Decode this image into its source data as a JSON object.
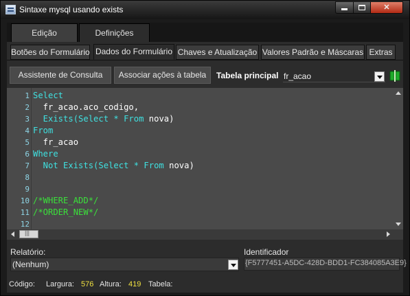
{
  "window": {
    "title": "Sintaxe mysql usando exists"
  },
  "main_tabs": [
    {
      "label": "Edição"
    },
    {
      "label": "Definições"
    }
  ],
  "sub_tabs": [
    {
      "label": "Botões do Formulário"
    },
    {
      "label": "Dados do Formulário"
    },
    {
      "label": "Chaves e Atualização"
    },
    {
      "label": "Valores Padrão e Máscaras"
    },
    {
      "label": "Extras"
    }
  ],
  "toolbar": {
    "query_wizard_label": "Assistente de Consulta",
    "associate_actions_label": "Associar ações à tabela",
    "main_table_label": "Tabela principal",
    "main_table_value": "fr_acao"
  },
  "editor": {
    "line_numbers": [
      "1",
      "2",
      "3",
      "4",
      "5",
      "6",
      "7",
      "8",
      "9",
      "10",
      "11",
      "12"
    ],
    "lines": [
      [
        {
          "t": "Select",
          "c": "kw"
        }
      ],
      [
        {
          "t": "  fr_acao.aco_codigo,",
          "c": "id"
        }
      ],
      [
        {
          "t": "  Exists(Select * From ",
          "c": "kw"
        },
        {
          "t": "nova)",
          "c": "id"
        }
      ],
      [
        {
          "t": "From",
          "c": "kw"
        }
      ],
      [
        {
          "t": "  fr_acao",
          "c": "id"
        }
      ],
      [
        {
          "t": "Where",
          "c": "kw"
        }
      ],
      [
        {
          "t": "  Not Exists(Select * From ",
          "c": "kw"
        },
        {
          "t": "nova)",
          "c": "id"
        }
      ],
      [],
      [],
      [
        {
          "t": "/*WHERE_ADD*/",
          "c": "cm"
        }
      ],
      [
        {
          "t": "/*ORDER_NEW*/",
          "c": "cm"
        }
      ],
      []
    ]
  },
  "footer": {
    "relatorio_label": "Relatório:",
    "relatorio_value": "(Nenhum)",
    "identificador_label": "Identificador",
    "identificador_value": "{F5777451-A5DC-428D-BDD1-FC384085A3E9}"
  },
  "status": {
    "codigo_label": "Código:",
    "largura_label": "Largura:",
    "largura_value": "576",
    "altura_label": "Altura:",
    "altura_value": "419",
    "tabela_label": "Tabela:"
  },
  "icons": {
    "app": "window-app-icon",
    "minimize": "minimize-icon",
    "maximize": "maximize-icon",
    "close": "close-icon",
    "book": "book-icon"
  },
  "colors": {
    "keyword": "#3fe0e0",
    "identifier": "#ffffff",
    "comment": "#3be03b",
    "status_number": "#f0e040",
    "close_button": "#c8402a"
  }
}
